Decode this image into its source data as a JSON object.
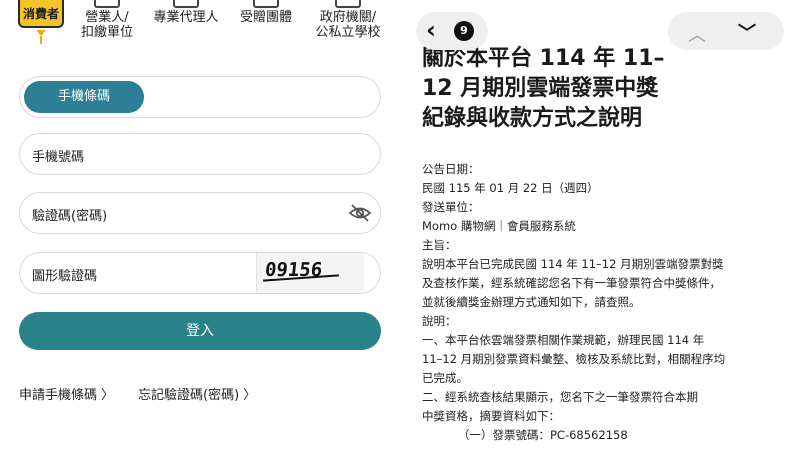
{
  "login": {
    "categories": {
      "active": "消費者",
      "items": [
        "營業人/\n扣繳單位",
        "專業代理人",
        "受贈團體",
        "政府機關/\n公私立學校"
      ]
    },
    "barcode_tab": "手機條碼",
    "phone_placeholder": "手機號碼",
    "password_placeholder": "驗證碼(密碼)",
    "captcha_label": "圖形驗證碼",
    "captcha_code": "09156",
    "login_button": "登入",
    "links": {
      "apply": "申請手機條碼",
      "forgot": "忘記驗證碼(密碼)"
    }
  },
  "announcement": {
    "tab_count": "9",
    "title_lines": [
      "關於本平台 114 年 11–",
      "12 月期別雲端發票中獎",
      "紀錄與收款方式之說明"
    ],
    "body_lines": [
      "公告日期：",
      "民國 115 年 01 月 22 日（週四）",
      "發送單位：",
      "Momo 購物網｜會員服務系統",
      "主旨：",
      "說明本平台已完成民國 114 年 11–12 月期別雲端發票對獎",
      "及查核作業，經系統確認您名下有一筆發票符合中獎條件，",
      "並就後續獎金辦理方式通知如下，請查照。",
      "說明：",
      "一、本平台依雲端發票相關作業規範，辦理民國 114 年",
      "11–12 月期別發票資料彙整、檢核及系統比對，相關程序均",
      "已完成。",
      "二、經系統查核結果顯示，您名下之一筆發票符合本期",
      "中獎資格，摘要資料如下：",
      "（一）發票號碼：PC-68562158"
    ]
  }
}
